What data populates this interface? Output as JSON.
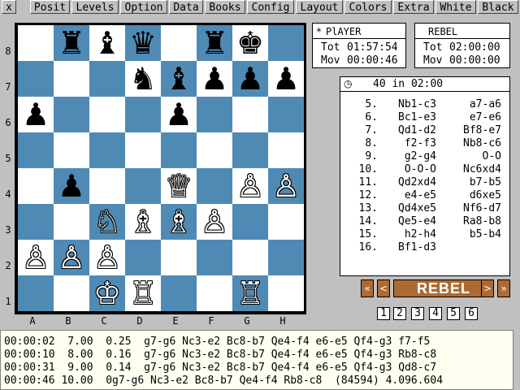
{
  "menu": {
    "close": "x",
    "items": [
      "Posit",
      "Levels",
      "Option",
      "Data",
      "Books",
      "Config",
      "Layout",
      "Colors",
      "Extra",
      "White",
      "Black"
    ]
  },
  "board": {
    "files": [
      "A",
      "B",
      "C",
      "D",
      "E",
      "F",
      "G",
      "H"
    ],
    "ranks": [
      "8",
      "7",
      "6",
      "5",
      "4",
      "3",
      "2",
      "1"
    ],
    "pieces": [
      {
        "sq": "b8",
        "p": "r",
        "c": "black"
      },
      {
        "sq": "c8",
        "p": "b",
        "c": "black"
      },
      {
        "sq": "d8",
        "p": "q",
        "c": "black"
      },
      {
        "sq": "f8",
        "p": "r",
        "c": "black"
      },
      {
        "sq": "g8",
        "p": "k",
        "c": "black"
      },
      {
        "sq": "d7",
        "p": "n",
        "c": "black"
      },
      {
        "sq": "e7",
        "p": "b",
        "c": "black"
      },
      {
        "sq": "f7",
        "p": "p",
        "c": "black"
      },
      {
        "sq": "g7",
        "p": "p",
        "c": "black"
      },
      {
        "sq": "h7",
        "p": "p",
        "c": "black"
      },
      {
        "sq": "a6",
        "p": "p",
        "c": "black"
      },
      {
        "sq": "e6",
        "p": "p",
        "c": "black"
      },
      {
        "sq": "b4",
        "p": "p",
        "c": "black"
      },
      {
        "sq": "e4",
        "p": "q",
        "c": "white"
      },
      {
        "sq": "g4",
        "p": "p",
        "c": "white"
      },
      {
        "sq": "h4",
        "p": "p",
        "c": "white"
      },
      {
        "sq": "c3",
        "p": "n",
        "c": "white"
      },
      {
        "sq": "d3",
        "p": "b",
        "c": "white"
      },
      {
        "sq": "e3",
        "p": "b",
        "c": "white"
      },
      {
        "sq": "f3",
        "p": "p",
        "c": "white"
      },
      {
        "sq": "a2",
        "p": "p",
        "c": "white"
      },
      {
        "sq": "b2",
        "p": "p",
        "c": "white"
      },
      {
        "sq": "c2",
        "p": "p",
        "c": "white"
      },
      {
        "sq": "c1",
        "p": "k",
        "c": "white"
      },
      {
        "sq": "d1",
        "p": "r",
        "c": "white"
      },
      {
        "sq": "g1",
        "p": "r",
        "c": "white"
      }
    ],
    "light_color": "#ffffff",
    "dark_color": "#4f8ab5"
  },
  "clocks": {
    "player": {
      "marker": "*",
      "name": "PlAYER",
      "tot_label": "Tot",
      "tot": "01:57:54",
      "mov_label": "Mov",
      "mov": "00:00:46"
    },
    "engine": {
      "name": "REBEL",
      "tot_label": "Tot",
      "tot": "02:00:00",
      "mov_label": "Mov",
      "mov": "00:00:00"
    }
  },
  "moves_panel": {
    "icon": "clock-icon",
    "header": "40 in 02:00",
    "rows": [
      {
        "n": "5.",
        "w": "Nb1-c3",
        "b": "a7-a6"
      },
      {
        "n": "6.",
        "w": "Bc1-e3",
        "b": "e7-e6"
      },
      {
        "n": "7.",
        "w": "Qd1-d2",
        "b": "Bf8-e7"
      },
      {
        "n": "8.",
        "w": "f2-f3",
        "b": "Nb8-c6"
      },
      {
        "n": "9.",
        "w": "g2-g4",
        "b": "O-O"
      },
      {
        "n": "10.",
        "w": "O-O-O",
        "b": "Nc6xd4"
      },
      {
        "n": "11.",
        "w": "Qd2xd4",
        "b": "b7-b5"
      },
      {
        "n": "12.",
        "w": "e4-e5",
        "b": "d6xe5"
      },
      {
        "n": "13.",
        "w": "Qd4xe5",
        "b": "Nf6-d7"
      },
      {
        "n": "14.",
        "w": "Qe5-e4",
        "b": "Ra8-b8"
      },
      {
        "n": "15.",
        "w": "h2-h4",
        "b": "b5-b4"
      },
      {
        "n": "16.",
        "w": "Bf1-d3",
        "b": ""
      }
    ]
  },
  "nav": {
    "first": "«",
    "prev": "<",
    "engine_name": "REBEL",
    "next": ">",
    "last": "»",
    "numbers": [
      "1",
      "2",
      "3",
      "4",
      "5",
      "6"
    ],
    "accent": "#ad6a32"
  },
  "analysis": {
    "lines": [
      "00:00:02  7.00  0.25  g7-g6 Nc3-e2 Bc8-b7 Qe4-f4 e6-e5 Qf4-g3 f7-f5",
      "00:00:10  8.00  0.16  g7-g6 Nc3-e2 Bc8-b7 Qe4-f4 e6-e5 Qf4-g3 Rb8-c8",
      "00:00:31  9.00  0.14  g7-g6 Nc3-e2 Bc8-b7 Qe4-f4 e6-e5 Qf4-g3 Qd8-c7",
      "00:00:46 10.00  0g7-g6 Nc3-e2 Bc8-b7 Qe4-f4 Rb8-c8  (84594) 4.096.604"
    ]
  }
}
